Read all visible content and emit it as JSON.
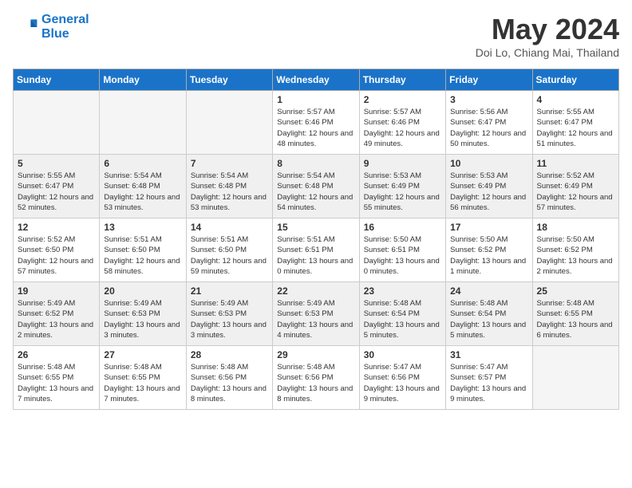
{
  "header": {
    "logo_line1": "General",
    "logo_line2": "Blue",
    "month": "May 2024",
    "location": "Doi Lo, Chiang Mai, Thailand"
  },
  "days_of_week": [
    "Sunday",
    "Monday",
    "Tuesday",
    "Wednesday",
    "Thursday",
    "Friday",
    "Saturday"
  ],
  "weeks": [
    [
      {
        "day": "",
        "empty": true
      },
      {
        "day": "",
        "empty": true
      },
      {
        "day": "",
        "empty": true
      },
      {
        "day": "1",
        "sunrise": "5:57 AM",
        "sunset": "6:46 PM",
        "daylight": "12 hours and 48 minutes."
      },
      {
        "day": "2",
        "sunrise": "5:57 AM",
        "sunset": "6:46 PM",
        "daylight": "12 hours and 49 minutes."
      },
      {
        "day": "3",
        "sunrise": "5:56 AM",
        "sunset": "6:47 PM",
        "daylight": "12 hours and 50 minutes."
      },
      {
        "day": "4",
        "sunrise": "5:55 AM",
        "sunset": "6:47 PM",
        "daylight": "12 hours and 51 minutes."
      }
    ],
    [
      {
        "day": "5",
        "sunrise": "5:55 AM",
        "sunset": "6:47 PM",
        "daylight": "12 hours and 52 minutes."
      },
      {
        "day": "6",
        "sunrise": "5:54 AM",
        "sunset": "6:48 PM",
        "daylight": "12 hours and 53 minutes."
      },
      {
        "day": "7",
        "sunrise": "5:54 AM",
        "sunset": "6:48 PM",
        "daylight": "12 hours and 53 minutes."
      },
      {
        "day": "8",
        "sunrise": "5:54 AM",
        "sunset": "6:48 PM",
        "daylight": "12 hours and 54 minutes."
      },
      {
        "day": "9",
        "sunrise": "5:53 AM",
        "sunset": "6:49 PM",
        "daylight": "12 hours and 55 minutes."
      },
      {
        "day": "10",
        "sunrise": "5:53 AM",
        "sunset": "6:49 PM",
        "daylight": "12 hours and 56 minutes."
      },
      {
        "day": "11",
        "sunrise": "5:52 AM",
        "sunset": "6:49 PM",
        "daylight": "12 hours and 57 minutes."
      }
    ],
    [
      {
        "day": "12",
        "sunrise": "5:52 AM",
        "sunset": "6:50 PM",
        "daylight": "12 hours and 57 minutes."
      },
      {
        "day": "13",
        "sunrise": "5:51 AM",
        "sunset": "6:50 PM",
        "daylight": "12 hours and 58 minutes."
      },
      {
        "day": "14",
        "sunrise": "5:51 AM",
        "sunset": "6:50 PM",
        "daylight": "12 hours and 59 minutes."
      },
      {
        "day": "15",
        "sunrise": "5:51 AM",
        "sunset": "6:51 PM",
        "daylight": "13 hours and 0 minutes."
      },
      {
        "day": "16",
        "sunrise": "5:50 AM",
        "sunset": "6:51 PM",
        "daylight": "13 hours and 0 minutes."
      },
      {
        "day": "17",
        "sunrise": "5:50 AM",
        "sunset": "6:52 PM",
        "daylight": "13 hours and 1 minute."
      },
      {
        "day": "18",
        "sunrise": "5:50 AM",
        "sunset": "6:52 PM",
        "daylight": "13 hours and 2 minutes."
      }
    ],
    [
      {
        "day": "19",
        "sunrise": "5:49 AM",
        "sunset": "6:52 PM",
        "daylight": "13 hours and 2 minutes."
      },
      {
        "day": "20",
        "sunrise": "5:49 AM",
        "sunset": "6:53 PM",
        "daylight": "13 hours and 3 minutes."
      },
      {
        "day": "21",
        "sunrise": "5:49 AM",
        "sunset": "6:53 PM",
        "daylight": "13 hours and 3 minutes."
      },
      {
        "day": "22",
        "sunrise": "5:49 AM",
        "sunset": "6:53 PM",
        "daylight": "13 hours and 4 minutes."
      },
      {
        "day": "23",
        "sunrise": "5:48 AM",
        "sunset": "6:54 PM",
        "daylight": "13 hours and 5 minutes."
      },
      {
        "day": "24",
        "sunrise": "5:48 AM",
        "sunset": "6:54 PM",
        "daylight": "13 hours and 5 minutes."
      },
      {
        "day": "25",
        "sunrise": "5:48 AM",
        "sunset": "6:55 PM",
        "daylight": "13 hours and 6 minutes."
      }
    ],
    [
      {
        "day": "26",
        "sunrise": "5:48 AM",
        "sunset": "6:55 PM",
        "daylight": "13 hours and 7 minutes."
      },
      {
        "day": "27",
        "sunrise": "5:48 AM",
        "sunset": "6:55 PM",
        "daylight": "13 hours and 7 minutes."
      },
      {
        "day": "28",
        "sunrise": "5:48 AM",
        "sunset": "6:56 PM",
        "daylight": "13 hours and 8 minutes."
      },
      {
        "day": "29",
        "sunrise": "5:48 AM",
        "sunset": "6:56 PM",
        "daylight": "13 hours and 8 minutes."
      },
      {
        "day": "30",
        "sunrise": "5:47 AM",
        "sunset": "6:56 PM",
        "daylight": "13 hours and 9 minutes."
      },
      {
        "day": "31",
        "sunrise": "5:47 AM",
        "sunset": "6:57 PM",
        "daylight": "13 hours and 9 minutes."
      },
      {
        "day": "",
        "empty": true
      }
    ]
  ]
}
